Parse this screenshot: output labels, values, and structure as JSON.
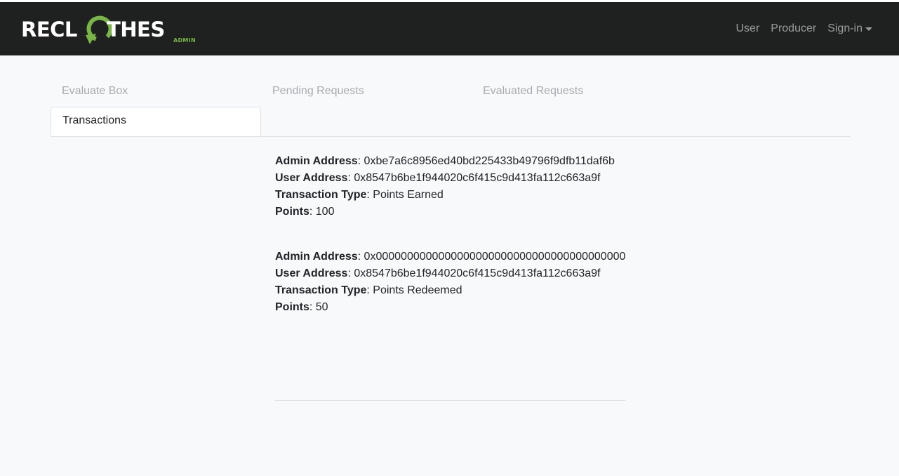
{
  "brand": {
    "left_text": "RECL",
    "right_text": "THES",
    "subtitle": "ADMIN",
    "logo_icon": "recycle-arrow-icon",
    "accent_color": "#7ab547"
  },
  "nav": {
    "links": [
      "User",
      "Producer"
    ],
    "signin_label": "Sign-in"
  },
  "tabs": [
    "Evaluate Box",
    "Pending Requests",
    "Evaluated Requests",
    "Transactions"
  ],
  "active_tab": "Transactions",
  "labels": {
    "admin_address": "Admin Address",
    "user_address": "User Address",
    "transaction_type": "Transaction Type",
    "points": "Points"
  },
  "transactions": [
    {
      "admin_address": ": 0xbe7a6c8956ed40bd225433b49796f9dfb11daf6b",
      "user_address": ": 0x8547b6be1f944020c6f415c9d413fa112c663a9f",
      "transaction_type": ": Points Earned",
      "points": ": 100"
    },
    {
      "admin_address": ": 0x0000000000000000000000000000000000000000",
      "user_address": ": 0x8547b6be1f944020c6f415c9d413fa112c663a9f",
      "transaction_type": ": Points Redeemed",
      "points": ": 50"
    }
  ]
}
